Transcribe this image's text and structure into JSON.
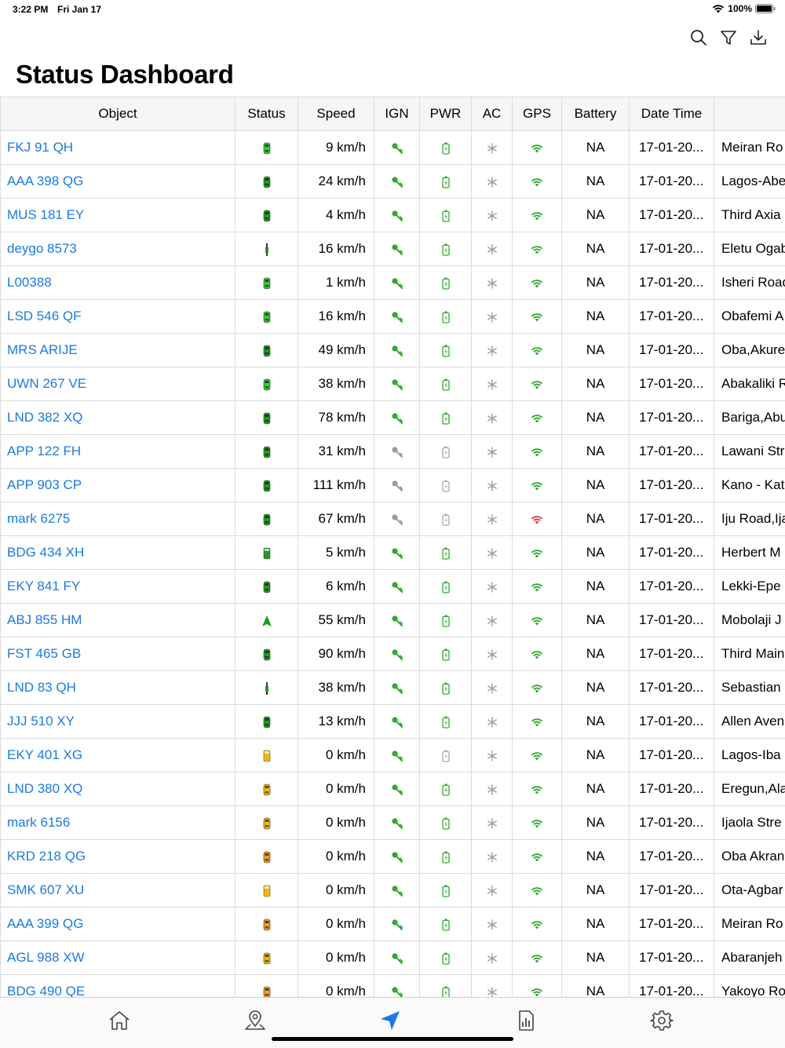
{
  "status_bar": {
    "time": "3:22 PM",
    "date": "Fri Jan 17",
    "battery": "100%"
  },
  "toolbar": {
    "search_icon": "magnifier",
    "filter_icon": "funnel",
    "export_icon": "download-tray"
  },
  "page": {
    "title": "Status Dashboard"
  },
  "table": {
    "columns": [
      "Object",
      "Status",
      "Speed",
      "IGN",
      "PWR",
      "AC",
      "GPS",
      "Battery",
      "Date Time",
      ""
    ],
    "rows": [
      {
        "object": "FKJ 91 QH",
        "status": "car-lightgreen",
        "speed": "9 km/h",
        "ign": "on",
        "pwr": "on",
        "gps": "ok",
        "battery": "NA",
        "datetime": "17-01-20...",
        "location": "Meiran Ro"
      },
      {
        "object": "AAA 398 QG",
        "status": "car-green",
        "speed": "24 km/h",
        "ign": "on",
        "pwr": "on",
        "gps": "ok",
        "battery": "NA",
        "datetime": "17-01-20...",
        "location": "Lagos-Abe"
      },
      {
        "object": "MUS 181 EY",
        "status": "car-green",
        "speed": "4 km/h",
        "ign": "on",
        "pwr": "on",
        "gps": "ok",
        "battery": "NA",
        "datetime": "17-01-20...",
        "location": "Third Axia"
      },
      {
        "object": "deygo 8573",
        "status": "side-green",
        "speed": "16 km/h",
        "ign": "on",
        "pwr": "on",
        "gps": "ok",
        "battery": "NA",
        "datetime": "17-01-20...",
        "location": "Eletu Ogab"
      },
      {
        "object": "L00388",
        "status": "car-lightgreen",
        "speed": "1 km/h",
        "ign": "on",
        "pwr": "on",
        "gps": "ok",
        "battery": "NA",
        "datetime": "17-01-20...",
        "location": "Isheri Road"
      },
      {
        "object": "LSD 546 QF",
        "status": "car-lightgreen",
        "speed": "16 km/h",
        "ign": "on",
        "pwr": "on",
        "gps": "ok",
        "battery": "NA",
        "datetime": "17-01-20...",
        "location": "Obafemi A"
      },
      {
        "object": "MRS ARIJE",
        "status": "car-green",
        "speed": "49 km/h",
        "ign": "on",
        "pwr": "on",
        "gps": "ok",
        "battery": "NA",
        "datetime": "17-01-20...",
        "location": "Oba,Akure"
      },
      {
        "object": "UWN 267 VE",
        "status": "car-lightgreen",
        "speed": "38 km/h",
        "ign": "on",
        "pwr": "on",
        "gps": "ok",
        "battery": "NA",
        "datetime": "17-01-20...",
        "location": "Abakaliki R"
      },
      {
        "object": "LND 382 XQ",
        "status": "car-green",
        "speed": "78 km/h",
        "ign": "on",
        "pwr": "on",
        "gps": "ok",
        "battery": "NA",
        "datetime": "17-01-20...",
        "location": "Bariga,Abu"
      },
      {
        "object": "APP 122 FH",
        "status": "car-green",
        "speed": "31 km/h",
        "ign": "off",
        "pwr": "off",
        "gps": "ok",
        "battery": "NA",
        "datetime": "17-01-20...",
        "location": "Lawani Str"
      },
      {
        "object": "APP 903 CP",
        "status": "car-green",
        "speed": "111 km/h",
        "ign": "off",
        "pwr": "off",
        "gps": "ok",
        "battery": "NA",
        "datetime": "17-01-20...",
        "location": "Kano - Kat"
      },
      {
        "object": "mark 6275",
        "status": "car-green",
        "speed": "67 km/h",
        "ign": "off",
        "pwr": "off",
        "gps": "bad",
        "battery": "NA",
        "datetime": "17-01-20...",
        "location": "Iju Road,Ija"
      },
      {
        "object": "BDG 434 XH",
        "status": "truck-green",
        "speed": "5 km/h",
        "ign": "on",
        "pwr": "on",
        "gps": "ok",
        "battery": "NA",
        "datetime": "17-01-20...",
        "location": "Herbert M"
      },
      {
        "object": "EKY 841 FY",
        "status": "car-green",
        "speed": "6 km/h",
        "ign": "on",
        "pwr": "on",
        "gps": "ok",
        "battery": "NA",
        "datetime": "17-01-20...",
        "location": "Lekki-Epe"
      },
      {
        "object": "ABJ 855 HM",
        "status": "arrow-green",
        "speed": "55 km/h",
        "ign": "on",
        "pwr": "on",
        "gps": "ok",
        "battery": "NA",
        "datetime": "17-01-20...",
        "location": "Mobolaji J"
      },
      {
        "object": "FST 465 GB",
        "status": "car-green",
        "speed": "90 km/h",
        "ign": "on",
        "pwr": "on",
        "gps": "ok",
        "battery": "NA",
        "datetime": "17-01-20...",
        "location": "Third Main"
      },
      {
        "object": "LND 83  QH",
        "status": "side-green",
        "speed": "38 km/h",
        "ign": "on",
        "pwr": "on",
        "gps": "ok",
        "battery": "NA",
        "datetime": "17-01-20...",
        "location": "Sebastian"
      },
      {
        "object": "JJJ 510 XY",
        "status": "car-green",
        "speed": "13 km/h",
        "ign": "on",
        "pwr": "on",
        "gps": "ok",
        "battery": "NA",
        "datetime": "17-01-20...",
        "location": "Allen Aven"
      },
      {
        "object": "EKY 401 XG",
        "status": "truck-yellow",
        "speed": "0 km/h",
        "ign": "on",
        "pwr": "off",
        "gps": "ok",
        "battery": "NA",
        "datetime": "17-01-20...",
        "location": "Lagos-Iba"
      },
      {
        "object": "LND 380 XQ",
        "status": "car-yellow",
        "speed": "0 km/h",
        "ign": "on",
        "pwr": "on",
        "gps": "ok",
        "battery": "NA",
        "datetime": "17-01-20...",
        "location": "Eregun,Ala"
      },
      {
        "object": "mark 6156",
        "status": "car-yellow",
        "speed": "0 km/h",
        "ign": "on",
        "pwr": "on",
        "gps": "ok",
        "battery": "NA",
        "datetime": "17-01-20...",
        "location": "Ijaola Stre"
      },
      {
        "object": "KRD 218 QG",
        "status": "car-orange",
        "speed": "0 km/h",
        "ign": "on",
        "pwr": "on",
        "gps": "ok",
        "battery": "NA",
        "datetime": "17-01-20...",
        "location": "Oba Akran"
      },
      {
        "object": "SMK 607 XU",
        "status": "truck-yellow",
        "speed": "0 km/h",
        "ign": "on",
        "pwr": "on",
        "gps": "ok",
        "battery": "NA",
        "datetime": "17-01-20...",
        "location": "Ota-Agbar"
      },
      {
        "object": "AAA 399 QG",
        "status": "car-orange",
        "speed": "0 km/h",
        "ign": "on",
        "pwr": "on",
        "gps": "ok",
        "battery": "NA",
        "datetime": "17-01-20...",
        "location": "Meiran Ro"
      },
      {
        "object": "AGL 988 XW",
        "status": "car-yellow",
        "speed": "0 km/h",
        "ign": "on",
        "pwr": "on",
        "gps": "ok",
        "battery": "NA",
        "datetime": "17-01-20...",
        "location": "Abaranjeh"
      },
      {
        "object": "BDG 490 QE",
        "status": "car-orange",
        "speed": "0 km/h",
        "ign": "on",
        "pwr": "on",
        "gps": "ok",
        "battery": "NA",
        "datetime": "17-01-20...",
        "location": "Yakoyo Ro"
      }
    ]
  },
  "tab_bar": {
    "tabs": [
      {
        "icon": "home-icon",
        "active": false
      },
      {
        "icon": "map-pin-icon",
        "active": false
      },
      {
        "icon": "location-arrow-icon",
        "active": true
      },
      {
        "icon": "report-icon",
        "active": false
      },
      {
        "icon": "settings-icon",
        "active": false
      }
    ]
  },
  "colors": {
    "link": "#1a7be0",
    "active_tab": "#1a7be0",
    "ign_on": "#2eaa2e",
    "ign_off": "#9a9a9a",
    "pwr_on": "#2eaa2e",
    "pwr_off": "#a9a9a9",
    "gps_ok": "#2eaa2e",
    "gps_bad": "#e23b3b",
    "ac": "#9e9e9e",
    "car_green": "#1f9a1f",
    "car_lightgreen": "#33cc33",
    "car_yellow": "#f5b800",
    "car_orange": "#f0a020"
  }
}
